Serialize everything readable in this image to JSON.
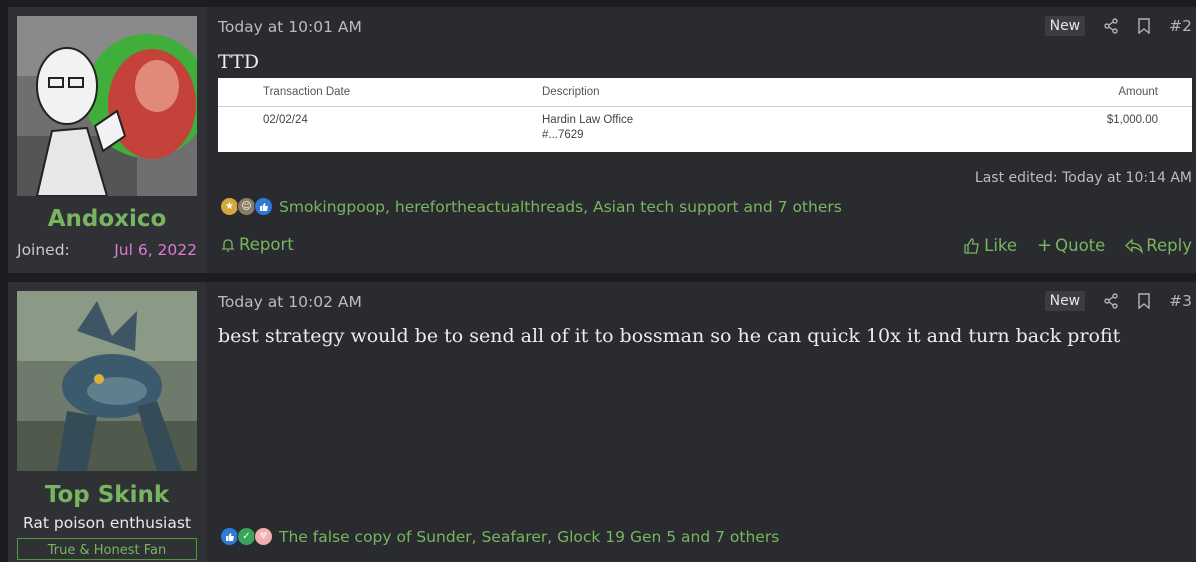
{
  "posts": [
    {
      "author": "Andoxico",
      "joined_label": "Joined:",
      "joined_date": "Jul 6, 2022",
      "time": "Today at 10:01 AM",
      "new_badge": "New",
      "post_number": "#2",
      "body": "TTD",
      "transaction": {
        "headers": [
          "Transaction Date",
          "Description",
          "Amount"
        ],
        "date": "02/02/24",
        "description": "Hardin Law Office",
        "reference": "#...7629",
        "amount": "$1,000.00"
      },
      "last_edited": "Last edited: Today at 10:14 AM",
      "reaction_icons": [
        "medal-icon",
        "face-icon",
        "thumbs-up-icon"
      ],
      "reactions_text": "Smokingpoop, herefortheactualthreads, Asian tech support and 7 others",
      "report_label": "Report",
      "like_label": "Like",
      "quote_label": "Quote",
      "reply_label": "Reply"
    },
    {
      "author": "Top Skink",
      "user_title": "Rat poison enthusiast",
      "banner": "True & Honest Fan",
      "time": "Today at 10:02 AM",
      "new_badge": "New",
      "post_number": "#3",
      "body": "best strategy would be to send all of it to bossman so he can quick 10x it and turn back profit",
      "reaction_icons": [
        "thumbs-up-icon",
        "check-icon",
        "heart-icon"
      ],
      "reactions_text": "The false copy of Sunder, Seafarer, Glock 19 Gen 5 and 7 others"
    }
  ],
  "colors": {
    "accent_green": "#78b560",
    "joined_date": "#e07ad8",
    "post_bg": "#2a2b2e",
    "sidebar_bg": "#303134",
    "page_bg": "#1c1d1f"
  }
}
